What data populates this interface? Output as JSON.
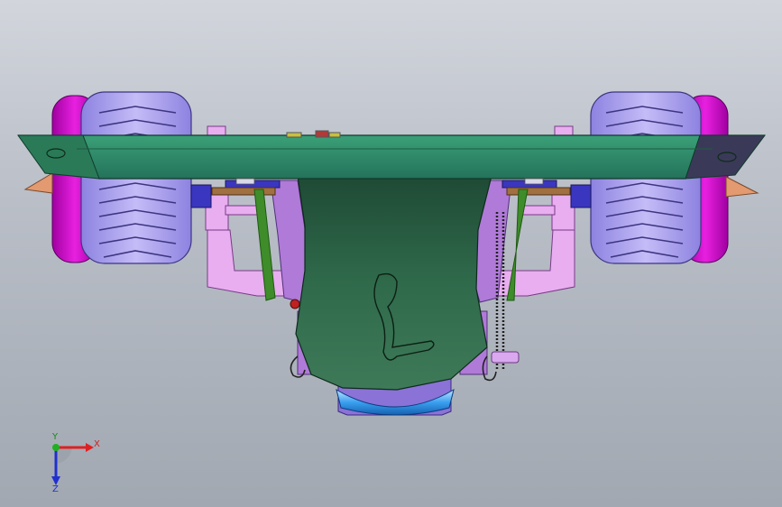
{
  "triad": {
    "x_label": "X",
    "y_label": "Y",
    "z_label": "Z",
    "x_color": "#e02020",
    "y_color": "#20b020",
    "z_color": "#2030d0"
  },
  "colors": {
    "background_top": "#d2d5dc",
    "background_bottom": "#a1a8b1",
    "wing": "#2f8f6a",
    "body": "#2e5a43",
    "tire": "#a79cf0",
    "rim": "#d010c8",
    "frame": "#e3a5ea",
    "lens": "#3aa0f0"
  }
}
